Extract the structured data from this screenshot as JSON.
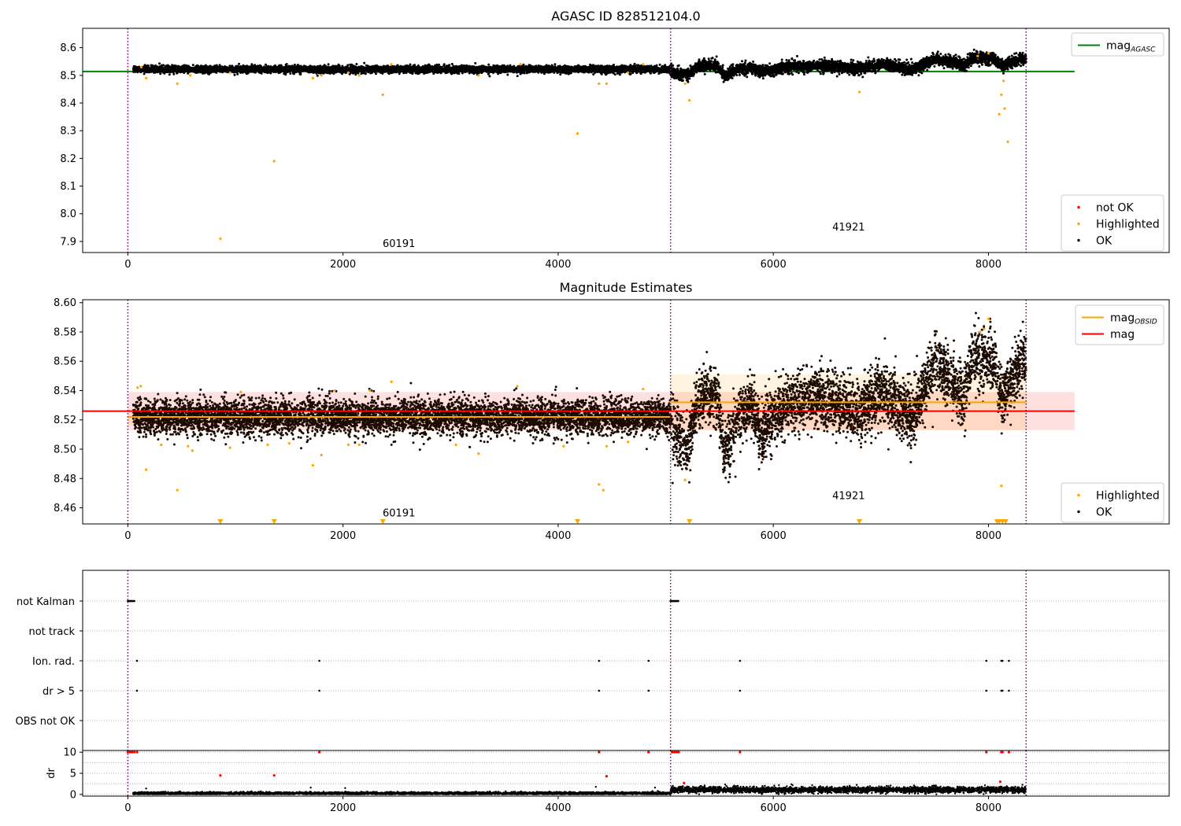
{
  "figure": {
    "panels": [
      {
        "title": "AGASC ID 828512104.0"
      },
      {
        "title": "Magnitude Estimates"
      },
      {
        "title": ""
      }
    ]
  },
  "colors": {
    "ok": "#000000",
    "highlighted": "#ffa500",
    "not_ok": "#ff0000",
    "mag_agasc": "#008000",
    "mag_obsid": "#ffa500",
    "mag": "#ff0000",
    "obsid_separator": "#800080",
    "band_mag": "#ff0000",
    "band_obsid": "#ffa500",
    "grid": "#b0b0b0"
  },
  "chart_data": [
    {
      "type": "scatter",
      "title": "AGASC ID 828512104.0",
      "xlabel": "",
      "ylabel": "",
      "xlim": [
        -420,
        9680
      ],
      "ylim": [
        7.86,
        8.67
      ],
      "xticks": [
        0,
        2000,
        4000,
        6000,
        8000
      ],
      "yticks": [
        7.9,
        8.0,
        8.1,
        8.2,
        8.3,
        8.4,
        8.5,
        8.6
      ],
      "ytick_labels": [
        "7.9",
        "8.0",
        "8.1",
        "8.2",
        "8.3",
        "8.4",
        "8.5",
        "8.6"
      ],
      "grid": false,
      "obsid_boundaries": [
        0,
        5045,
        8350
      ],
      "obsid_labels": [
        {
          "text": "60191",
          "x": 2520,
          "y": 7.88
        },
        {
          "text": "41921",
          "x": 6700,
          "y": 7.94
        }
      ],
      "lines": [
        {
          "name": "mag_AGASC",
          "label_main": "mag",
          "label_sub": "AGASC",
          "y": 8.514,
          "x": [
            -420,
            8800
          ]
        }
      ],
      "series": [
        {
          "name": "not OK",
          "points": []
        },
        {
          "name": "Highlighted",
          "points": [
            [
              125,
              8.53
            ],
            [
              170,
              8.49
            ],
            [
              460,
              8.47
            ],
            [
              580,
              8.5
            ],
            [
              860,
              7.91
            ],
            [
              950,
              8.51
            ],
            [
              1360,
              8.19
            ],
            [
              1720,
              8.49
            ],
            [
              1800,
              8.5
            ],
            [
              2050,
              8.51
            ],
            [
              2150,
              8.5
            ],
            [
              2370,
              8.43
            ],
            [
              2450,
              8.54
            ],
            [
              3260,
              8.5
            ],
            [
              3650,
              8.54
            ],
            [
              4180,
              8.29
            ],
            [
              4380,
              8.47
            ],
            [
              4450,
              8.47
            ],
            [
              4650,
              8.51
            ],
            [
              4790,
              8.54
            ],
            [
              5180,
              8.47
            ],
            [
              5220,
              8.41
            ],
            [
              6800,
              8.44
            ],
            [
              7900,
              8.57
            ],
            [
              8000,
              8.58
            ],
            [
              8100,
              8.36
            ],
            [
              8120,
              8.43
            ],
            [
              8140,
              8.48
            ],
            [
              8150,
              8.38
            ],
            [
              8180,
              8.26
            ]
          ]
        },
        {
          "name": "OK",
          "segments": [
            {
              "x0": 50,
              "x1": 5045,
              "mean": 8.522,
              "sd": 0.006
            },
            {
              "x0": 5045,
              "x1": 8350,
              "mean_path": [
                [
                  5045,
                  8.515
                ],
                [
                  5200,
                  8.5
                ],
                [
                  5300,
                  8.535
                ],
                [
                  5480,
                  8.535
                ],
                [
                  5550,
                  8.495
                ],
                [
                  5650,
                  8.52
                ],
                [
                  5800,
                  8.53
                ],
                [
                  5880,
                  8.51
                ],
                [
                  6100,
                  8.53
                ],
                [
                  6500,
                  8.535
                ],
                [
                  6800,
                  8.525
                ],
                [
                  7000,
                  8.54
                ],
                [
                  7300,
                  8.52
                ],
                [
                  7500,
                  8.56
                ],
                [
                  7780,
                  8.535
                ],
                [
                  7850,
                  8.565
                ],
                [
                  8050,
                  8.56
                ],
                [
                  8130,
                  8.535
                ],
                [
                  8350,
                  8.565
                ]
              ],
              "sd": 0.01
            }
          ]
        }
      ],
      "legends": [
        {
          "placement": "upper right",
          "items": [
            {
              "kind": "line",
              "color_key": "mag_agasc",
              "main": "mag",
              "sub": "AGASC"
            }
          ]
        },
        {
          "placement": "lower right",
          "items": [
            {
              "kind": "dot",
              "color_key": "not_ok",
              "label": "not OK"
            },
            {
              "kind": "dot",
              "color_key": "highlighted",
              "label": "Highlighted"
            },
            {
              "kind": "dot",
              "color_key": "ok",
              "label": "OK"
            }
          ]
        }
      ]
    },
    {
      "type": "scatter",
      "title": "Magnitude Estimates",
      "xlabel": "",
      "ylabel": "",
      "xlim": [
        -420,
        9680
      ],
      "ylim": [
        8.449,
        8.602
      ],
      "xticks": [
        0,
        2000,
        4000,
        6000,
        8000
      ],
      "yticks": [
        8.46,
        8.48,
        8.5,
        8.52,
        8.54,
        8.56,
        8.58,
        8.6
      ],
      "ytick_labels": [
        "8.46",
        "8.48",
        "8.50",
        "8.52",
        "8.54",
        "8.56",
        "8.58",
        "8.60"
      ],
      "grid": false,
      "obsid_boundaries": [
        0,
        5045,
        8350
      ],
      "obsid_labels": [
        {
          "text": "60191",
          "x": 2520,
          "y": 8.454
        },
        {
          "text": "41921",
          "x": 6700,
          "y": 8.466
        }
      ],
      "lines": [
        {
          "name": "mag_OBSID",
          "label_main": "mag",
          "label_sub": "OBSID",
          "segments": [
            {
              "x0": 0,
              "x1": 5045,
              "y": 8.522
            },
            {
              "x0": 5045,
              "x1": 8350,
              "y": 8.532
            }
          ]
        },
        {
          "name": "mag",
          "y": 8.526,
          "x": [
            -420,
            8800
          ]
        }
      ],
      "bands": [
        {
          "name": "mag",
          "x0": 0,
          "x1": 8800,
          "y0": 8.513,
          "y1": 8.539
        },
        {
          "name": "mag_OBSID 60191",
          "x0": 0,
          "x1": 5045,
          "y0": 8.517,
          "y1": 8.527
        },
        {
          "name": "mag_OBSID 41921",
          "x0": 5045,
          "x1": 8350,
          "y0": 8.513,
          "y1": 8.551
        }
      ],
      "series": [
        {
          "name": "Highlighted",
          "points": [
            [
              90,
              8.542
            ],
            [
              120,
              8.543
            ],
            [
              170,
              8.486
            ],
            [
              310,
              8.503
            ],
            [
              460,
              8.472
            ],
            [
              560,
              8.502
            ],
            [
              600,
              8.499
            ],
            [
              950,
              8.501
            ],
            [
              1050,
              8.539
            ],
            [
              1300,
              8.503
            ],
            [
              1500,
              8.504
            ],
            [
              1720,
              8.489
            ],
            [
              1800,
              8.496
            ],
            [
              1920,
              8.54
            ],
            [
              2050,
              8.503
            ],
            [
              2150,
              8.503
            ],
            [
              2250,
              8.54
            ],
            [
              2450,
              8.546
            ],
            [
              3050,
              8.503
            ],
            [
              3260,
              8.497
            ],
            [
              3620,
              8.543
            ],
            [
              4050,
              8.502
            ],
            [
              4380,
              8.476
            ],
            [
              4420,
              8.472
            ],
            [
              4450,
              8.502
            ],
            [
              4650,
              8.505
            ],
            [
              4790,
              8.541
            ],
            [
              5180,
              8.479
            ],
            [
              7920,
              8.58
            ],
            [
              7960,
              8.582
            ],
            [
              8000,
              8.589
            ],
            [
              8120,
              8.475
            ]
          ]
        },
        {
          "name": "Highlighted (clipped)",
          "points": [
            [
              860,
              8.449
            ],
            [
              1360,
              8.449
            ],
            [
              2370,
              8.449
            ],
            [
              4180,
              8.449
            ],
            [
              5220,
              8.449
            ],
            [
              6800,
              8.449
            ],
            [
              8080,
              8.449
            ],
            [
              8100,
              8.449
            ],
            [
              8130,
              8.449
            ],
            [
              8160,
              8.449
            ]
          ]
        },
        {
          "name": "OK",
          "segments": [
            {
              "x0": 50,
              "x1": 5045,
              "mean": 8.522,
              "sd": 0.006
            },
            {
              "x0": 5045,
              "x1": 8350,
              "mean_path": [
                [
                  5045,
                  8.515
                ],
                [
                  5200,
                  8.5
                ],
                [
                  5300,
                  8.535
                ],
                [
                  5480,
                  8.535
                ],
                [
                  5550,
                  8.495
                ],
                [
                  5650,
                  8.52
                ],
                [
                  5800,
                  8.53
                ],
                [
                  5880,
                  8.51
                ],
                [
                  6100,
                  8.53
                ],
                [
                  6500,
                  8.535
                ],
                [
                  6800,
                  8.525
                ],
                [
                  7000,
                  8.54
                ],
                [
                  7300,
                  8.52
                ],
                [
                  7500,
                  8.56
                ],
                [
                  7780,
                  8.535
                ],
                [
                  7850,
                  8.565
                ],
                [
                  8050,
                  8.56
                ],
                [
                  8130,
                  8.535
                ],
                [
                  8350,
                  8.565
                ]
              ],
              "sd": 0.01
            }
          ]
        }
      ],
      "legends": [
        {
          "placement": "upper right",
          "items": [
            {
              "kind": "line",
              "color_key": "mag_obsid",
              "main": "mag",
              "sub": "OBSID"
            },
            {
              "kind": "line",
              "color_key": "mag",
              "label": "mag"
            }
          ]
        },
        {
          "placement": "lower right",
          "items": [
            {
              "kind": "dot",
              "color_key": "highlighted",
              "label": "Highlighted"
            },
            {
              "kind": "dot",
              "color_key": "ok",
              "label": "OK"
            }
          ]
        }
      ]
    },
    {
      "type": "scatter",
      "title": "",
      "xlabel": "",
      "ylabel": "",
      "xlim": [
        -420,
        9680
      ],
      "categories": [
        "not Kalman",
        "not track",
        "Ion. rad.",
        "dr > 5",
        "OBS not OK"
      ],
      "grid": "dotted horizontal per category",
      "obsid_boundaries": [
        0,
        5045,
        8350
      ],
      "flags": [
        {
          "category": "not Kalman",
          "ranges": [
            [
              0,
              60
            ],
            [
              5045,
              5120
            ]
          ]
        },
        {
          "category": "not track",
          "ranges": []
        },
        {
          "category": "Ion. rad.",
          "x": [
            85,
            1780,
            4380,
            4840,
            5690,
            7980,
            8120,
            8130,
            8190
          ]
        },
        {
          "category": "dr > 5",
          "x": [
            85,
            1780,
            4380,
            4840,
            5690,
            7980,
            8120,
            8130,
            8190
          ]
        },
        {
          "category": "OBS not OK",
          "x": []
        }
      ]
    },
    {
      "type": "scatter",
      "title": "",
      "xlabel": "",
      "ylabel": "dr",
      "xlim": [
        -420,
        9680
      ],
      "ylim": [
        -0.4,
        10.4
      ],
      "xticks": [
        0,
        2000,
        4000,
        6000,
        8000
      ],
      "yticks": [
        0,
        5,
        10
      ],
      "ytick_labels": [
        "0",
        "5",
        "10"
      ],
      "grid": "dotted horizontal",
      "obsid_boundaries": [
        0,
        5045,
        8350
      ],
      "series": [
        {
          "name": "not OK",
          "points": [
            [
              0,
              10
            ],
            [
              20,
              10
            ],
            [
              40,
              10
            ],
            [
              60,
              10
            ],
            [
              85,
              10
            ],
            [
              860,
              4.5
            ],
            [
              1360,
              4.5
            ],
            [
              1780,
              10
            ],
            [
              4380,
              10
            ],
            [
              4450,
              4.3
            ],
            [
              4840,
              10
            ],
            [
              5060,
              10
            ],
            [
              5080,
              10
            ],
            [
              5100,
              10
            ],
            [
              5120,
              10
            ],
            [
              5170,
              2.7
            ],
            [
              5690,
              10
            ],
            [
              7980,
              10
            ],
            [
              8110,
              3.0
            ],
            [
              8120,
              10
            ],
            [
              8130,
              10
            ],
            [
              8190,
              10
            ]
          ]
        },
        {
          "name": "OK",
          "segments": [
            {
              "x0": 50,
              "x1": 5045,
              "mean": 0.25,
              "sd": 0.15
            },
            {
              "x0": 5045,
              "x1": 8350,
              "mean": 1.1,
              "sd": 0.35
            }
          ],
          "outliers": [
            [
              170,
              1.4
            ],
            [
              1700,
              1.6
            ],
            [
              2020,
              1.5
            ],
            [
              4350,
              1.8
            ],
            [
              4900,
              1.6
            ]
          ]
        }
      ]
    }
  ]
}
